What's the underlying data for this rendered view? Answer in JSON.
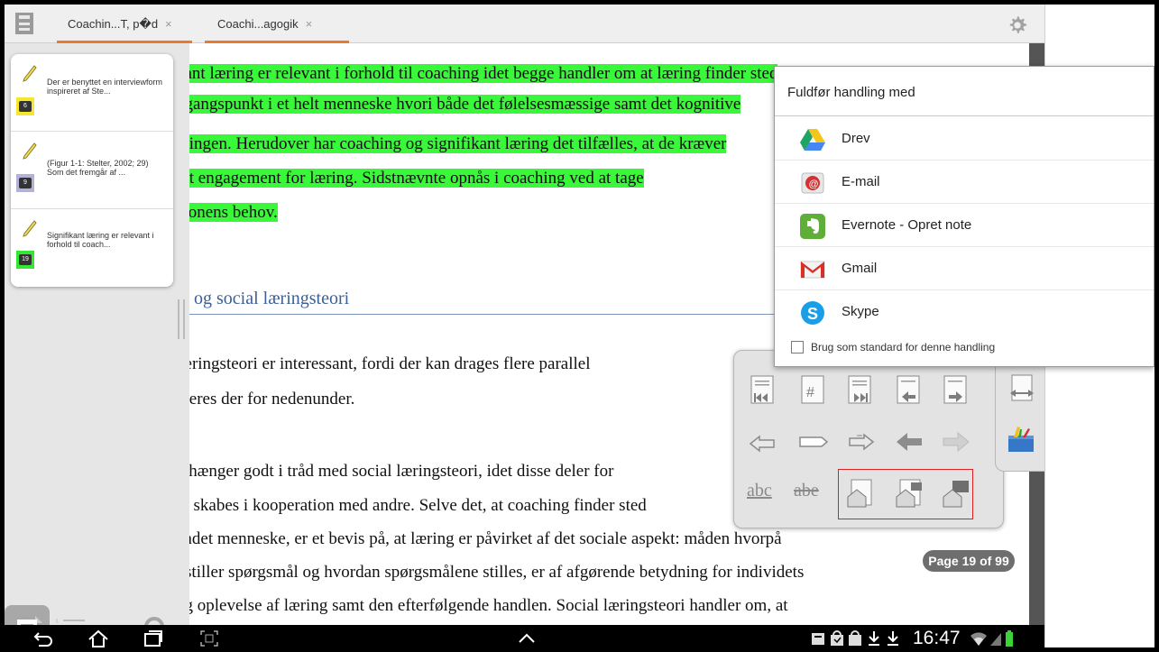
{
  "tabs": [
    {
      "label": "Coachin...T, p�d",
      "close": "×"
    },
    {
      "label": "Coachi...agogik",
      "close": "×"
    }
  ],
  "annotations": [
    {
      "text": "Der er benyttet en interviewform inspireret af Ste...",
      "page": "6",
      "color": "#f5e62f"
    },
    {
      "text": "(Figur 1-1: Stelter, 2002; 29) Som det fremgår af ...",
      "page": "9",
      "color": "#b2b2d8"
    },
    {
      "text": "Signifikant læring er relevant i forhold til coach...",
      "page": "19",
      "color": "#35e635"
    }
  ],
  "document": {
    "highlighted_lines": [
      "kant læring er relevant i forhold til coaching idet begge handler om at læring finder sted",
      "dgangspunkt i et helt menneske hvori både det følelsesmæssige samt det kognitive",
      "eringen. Herudover har coaching og signifikant læring det tilfælles, at de kræver",
      "igt engagement for læring. Sidstnævnte opnås i coaching ved at tage",
      "rsonens behov."
    ],
    "heading": "g og  social læringsteori",
    "body_lines": [
      "læringsteori er interessant, fordi der kan drages flere parallel",
      "nteres der for nedenunder.",
      "g hænger godt i tråd med social læringsteori, idet disse deler for",
      "er skabes i kooperation med andre. Selve det, at coaching finder sted",
      "andet menneske, er et bevis på, at læring er påvirket af det sociale aspekt: måden hvorpå",
      "i stiller spørgsmål og hvordan spørgsmålene stilles, er af afgørende betydning for individets",
      "og oplevelse af læring samt den efterfølgende handlen. Social læringsteori handler om, at"
    ]
  },
  "page_indicator": "Page 19 of 99",
  "toolbar": {
    "abc_label": "abc",
    "abe_label": "abe"
  },
  "share_dialog": {
    "title": "Fuldfør handling med",
    "items": [
      {
        "label": "Drev",
        "icon": "drive-icon"
      },
      {
        "label": "E-mail",
        "icon": "email-icon"
      },
      {
        "label": "Evernote - Opret note",
        "icon": "evernote-icon"
      },
      {
        "label": "Gmail",
        "icon": "gmail-icon"
      },
      {
        "label": "Skype",
        "icon": "skype-icon"
      }
    ],
    "default_checkbox": "Brug som standard for denne handling"
  },
  "status_bar": {
    "clock": "16:47"
  },
  "colors": {
    "highlight": "#39f739",
    "tab_accent": "#e87b30",
    "heading_blue": "#3b5f97"
  }
}
